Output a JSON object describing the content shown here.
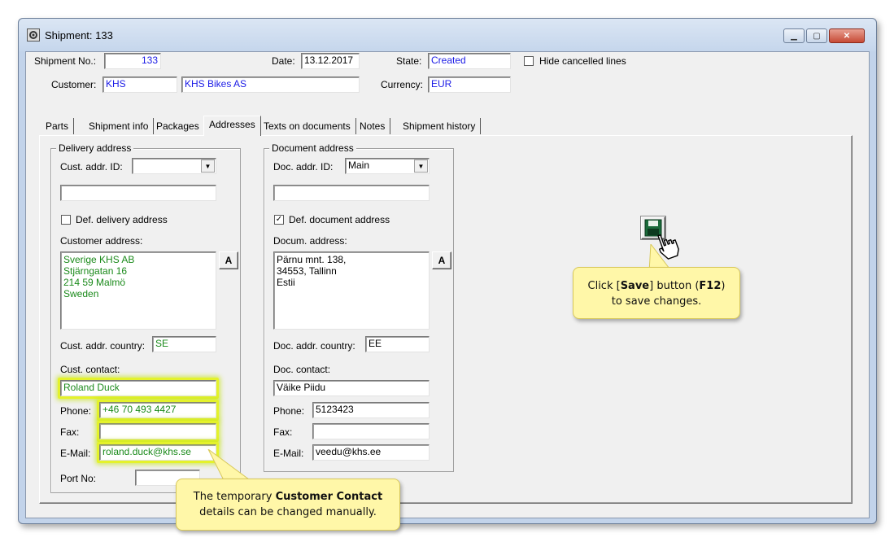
{
  "window": {
    "title": "Shipment: 133",
    "controls": [
      "minimize",
      "maximize",
      "close"
    ]
  },
  "header": {
    "shipment_no_label": "Shipment No.:",
    "shipment_no": "133",
    "date_label": "Date:",
    "date": "13.12.2017",
    "state_label": "State:",
    "state": "Created",
    "hide_cancelled_label": "Hide cancelled lines",
    "hide_cancelled_checked": false,
    "customer_label": "Customer:",
    "customer_code": "KHS",
    "customer_name": "KHS Bikes AS",
    "currency_label": "Currency:",
    "currency": "EUR"
  },
  "tabs": [
    {
      "label": "Parts",
      "active": false
    },
    {
      "label": "Shipment info",
      "active": false
    },
    {
      "label": "Packages",
      "active": false
    },
    {
      "label": "Addresses",
      "active": true
    },
    {
      "label": "Texts on documents",
      "active": false
    },
    {
      "label": "Notes",
      "active": false
    },
    {
      "label": "Shipment history",
      "active": false
    }
  ],
  "delivery": {
    "group_title": "Delivery address",
    "addr_id_label": "Cust. addr. ID:",
    "addr_id": "",
    "extra_field": "",
    "def_label": "Def. delivery address",
    "def_checked": false,
    "address_label": "Customer address:",
    "address": "Sverige KHS AB\nStjärngatan 16\n214 59 Malmö\nSweden",
    "a_button": "A",
    "country_label": "Cust. addr. country:",
    "country": "SE",
    "contact_label": "Cust. contact:",
    "contact": "Roland Duck",
    "phone_label": "Phone:",
    "phone": "+46 70 493 4427",
    "fax_label": "Fax:",
    "fax": "",
    "email_label": "E-Mail:",
    "email": "roland.duck@khs.se",
    "port_label": "Port No:",
    "port": ""
  },
  "document": {
    "group_title": "Document address",
    "addr_id_label": "Doc. addr. ID:",
    "addr_id": "Main",
    "extra_field": "",
    "def_label": "Def. document address",
    "def_checked": true,
    "address_label": "Docum. address:",
    "address": "Pärnu mnt. 138,\n34553, Tallinn\nEstii",
    "a_button": "A",
    "country_label": "Doc. addr. country:",
    "country": "EE",
    "contact_label": "Doc. contact:",
    "contact": "Väike Piidu",
    "phone_label": "Phone:",
    "phone": "5123423",
    "fax_label": "Fax:",
    "fax": "",
    "email_label": "E-Mail:",
    "email": "veedu@khs.ee"
  },
  "callouts": {
    "save_pre": "Click [",
    "save_b1": "Save",
    "save_mid": "] button (",
    "save_b2": "F12",
    "save_post": ")",
    "save_line2": "to save changes.",
    "contact_pre": "The temporary ",
    "contact_b": "Customer Contact",
    "contact_line2": "details can be changed manually."
  },
  "colors": {
    "highlight": "#e4f22b",
    "callout_bg": "#fff7a8",
    "value_blue": "#1a1ae6",
    "value_green": "#1a8a1a"
  }
}
